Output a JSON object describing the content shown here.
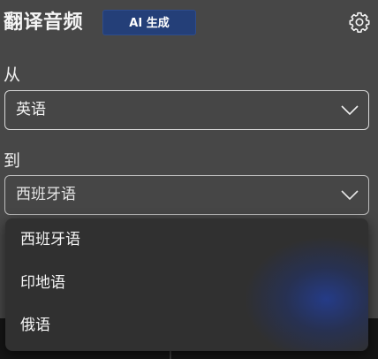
{
  "header": {
    "title": "翻译音频",
    "ai_badge": "AI 生成",
    "settings_icon": "gear-icon"
  },
  "source": {
    "label": "从",
    "selected": "英语"
  },
  "target": {
    "label": "到",
    "selected": "西班牙语",
    "options": [
      "西班牙语",
      "印地语",
      "俄语"
    ]
  },
  "colors": {
    "background": "#474747",
    "badge": "#243f78",
    "dropdown": "#303030",
    "glow": "#243c8c"
  }
}
